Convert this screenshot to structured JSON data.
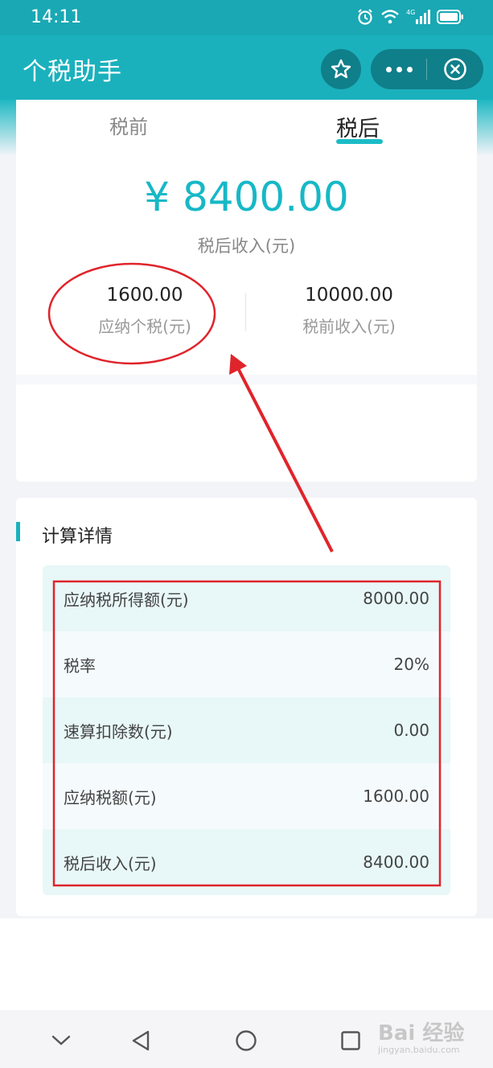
{
  "status_bar": {
    "time": "14:11",
    "network": "4G"
  },
  "nav": {
    "title": "个税助手"
  },
  "tabs": {
    "pre": "税前",
    "post": "税后"
  },
  "summary": {
    "amount": "¥ 8400.00",
    "amount_label": "税后收入(元)",
    "tax_value": "1600.00",
    "tax_label": "应纳个税(元)",
    "pretax_value": "10000.00",
    "pretax_label": "税前收入(元)"
  },
  "details": {
    "title": "计算详情",
    "rows": [
      {
        "label": "应纳税所得额(元)",
        "value": "8000.00"
      },
      {
        "label": "税率",
        "value": "20%"
      },
      {
        "label": "速算扣除数(元)",
        "value": "0.00"
      },
      {
        "label": "应纳税额(元)",
        "value": "1600.00"
      },
      {
        "label": "税后收入(元)",
        "value": "8400.00"
      }
    ]
  },
  "watermark": {
    "text": "Bai 经验",
    "sub": "jingyan.baidu.com"
  },
  "colors": {
    "accent": "#1ab1bd",
    "annotation": "#e0242b"
  }
}
